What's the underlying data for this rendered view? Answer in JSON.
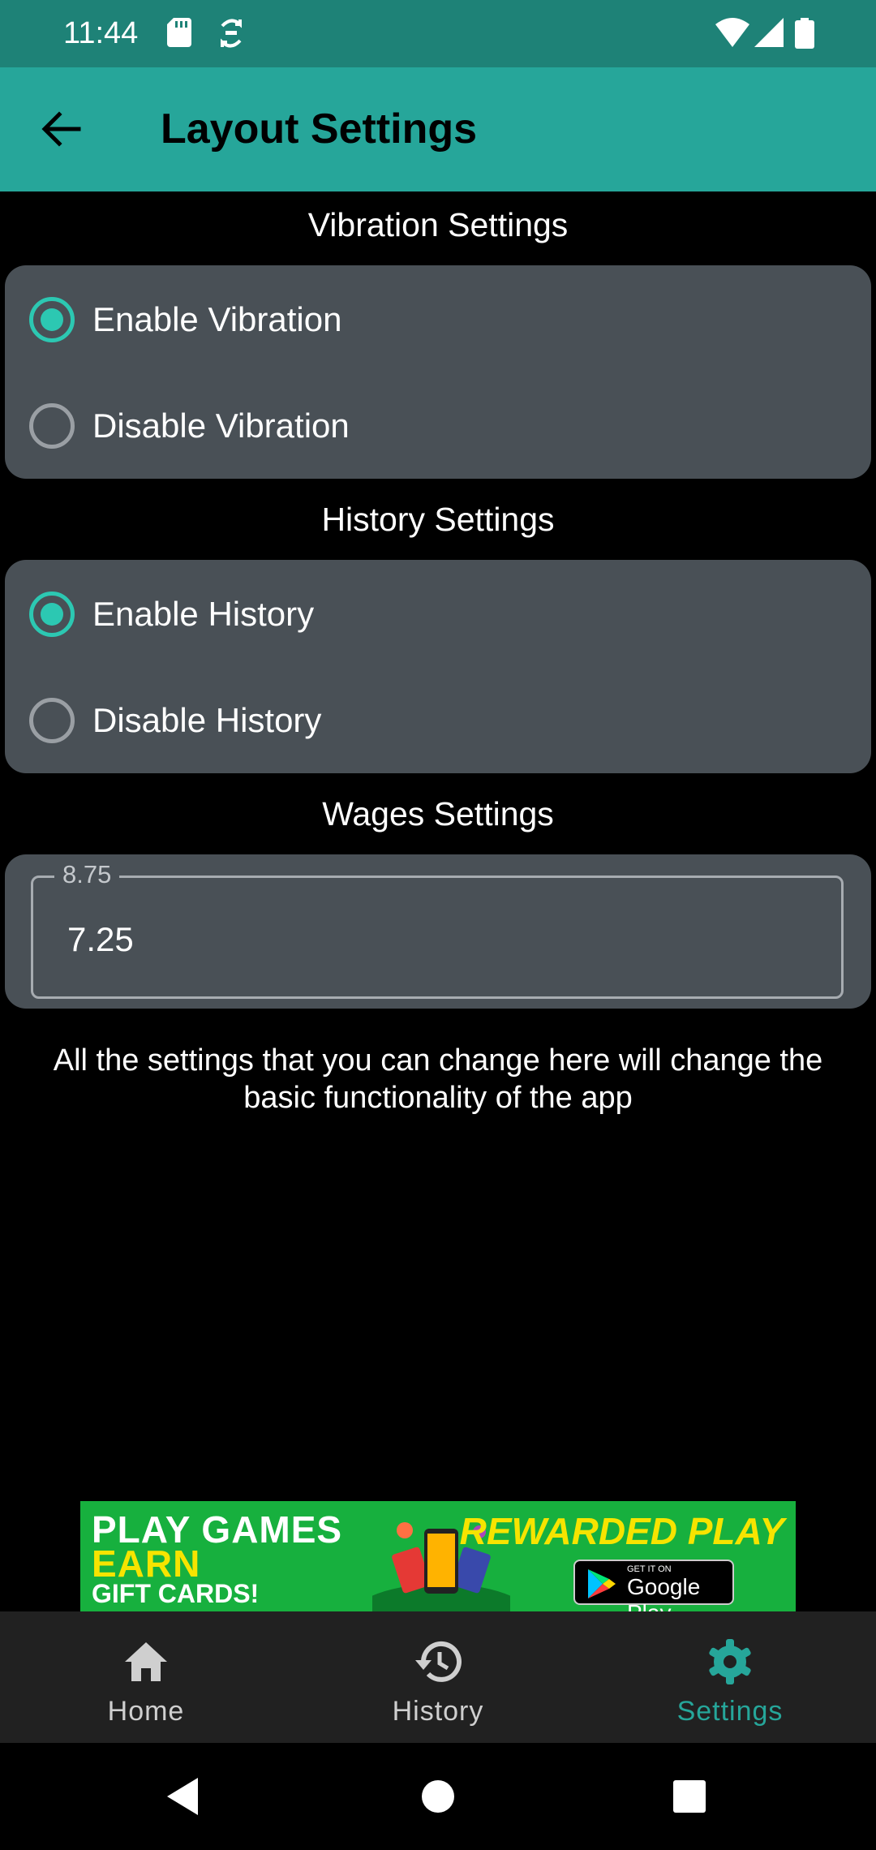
{
  "status_bar": {
    "time": "11:44"
  },
  "app_bar": {
    "title": "Layout Settings"
  },
  "vibration": {
    "title": "Vibration Settings",
    "options": [
      {
        "label": "Enable Vibration",
        "selected": true
      },
      {
        "label": "Disable Vibration",
        "selected": false
      }
    ]
  },
  "history": {
    "title": "History Settings",
    "options": [
      {
        "label": "Enable History",
        "selected": true
      },
      {
        "label": "Disable History",
        "selected": false
      }
    ]
  },
  "wages": {
    "title": "Wages Settings",
    "hint": "8.75",
    "value": "7.25"
  },
  "info_text": "All the settings that you can change here will change the basic functionality of the app",
  "ad": {
    "line1": "PLAY GAMES",
    "line2": "EARN",
    "line3": "GIFT CARDS!",
    "brand": "REWARDED PLAY",
    "store_small": "GET IT ON",
    "store_big": "Google Play"
  },
  "bottom_nav": {
    "items": [
      {
        "label": "Home",
        "icon": "home-icon",
        "active": false
      },
      {
        "label": "History",
        "icon": "history-icon",
        "active": false
      },
      {
        "label": "Settings",
        "icon": "settings-gear-icon",
        "active": true
      }
    ]
  },
  "colors": {
    "status_bar": "#1e8277",
    "app_bar": "#26a69a",
    "accent": "#2cc8b2",
    "card": "#495056",
    "background": "#000000",
    "nav_active": "#26a69a"
  }
}
